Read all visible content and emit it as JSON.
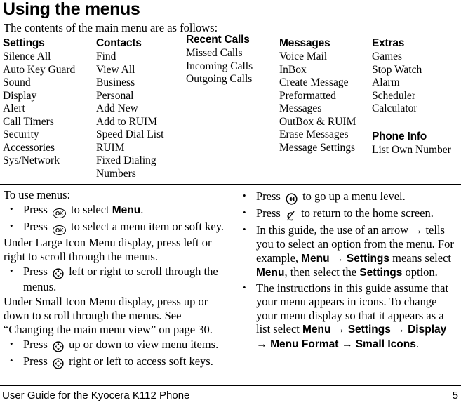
{
  "page": {
    "title": "Using the menus",
    "intro": "The contents of the main menu are as follows:"
  },
  "menu_map": {
    "columns": [
      {
        "heading": "Settings",
        "items": [
          "Silence All",
          "Auto Key Guard",
          "Sound",
          "Display",
          "Alert",
          "Call Timers",
          "Security",
          "Accessories",
          "Sys/Network"
        ]
      },
      {
        "heading": "Contacts",
        "items": [
          "Find",
          "View All",
          "Business",
          "Personal",
          "Add New",
          "Add to RUIM",
          "Speed Dial List",
          "RUIM",
          "Fixed Dialing Numbers"
        ]
      },
      {
        "heading": "Recent Calls",
        "items": [
          "Missed Calls",
          "Incoming Calls",
          "Outgoing Calls"
        ]
      },
      {
        "heading": "Messages",
        "items": [
          "Voice Mail",
          "InBox",
          "Create Message",
          "Preformatted Messages",
          "OutBox & RUIM",
          "Erase Messages",
          "Message Settings"
        ]
      },
      {
        "heading": "Extras",
        "items": [
          "Games",
          "Stop Watch",
          "Alarm",
          "Scheduler",
          "Calculator"
        ],
        "second_heading": "Phone Info",
        "second_items": [
          "List Own Number"
        ]
      }
    ]
  },
  "instructions": {
    "left": {
      "lead": "To use menus:",
      "bullet1_pre": "Press",
      "bullet1_mid": "to select",
      "bullet1_bold": "Menu",
      "bullet1_end": ".",
      "bullet2_pre": "Press",
      "bullet2_post": "to select a menu item or soft key.",
      "para1": "Under Large Icon Menu display, press left or right to scroll through the menus.",
      "bullet3_pre": "Press",
      "bullet3_post": "left or right to scroll through the menus.",
      "para2": "Under Small Icon Menu display, press up or down to scroll through the menus. See “Changing the main menu view” on page 30.",
      "bullet4_pre": "Press",
      "bullet4_post": "up or down to view menu items.",
      "bullet5_pre": "Press",
      "bullet5_post": "right or left to access soft keys."
    },
    "right": {
      "bullet1_pre": "Press",
      "bullet1_post": "to go up a menu level.",
      "bullet2_pre": "Press",
      "bullet2_post": "to return to the home screen.",
      "bullet3_part1": "In this guide, the use of an arrow",
      "bullet3_arrow": "→",
      "bullet3_part2": "tells you to select an option from the menu. For example,",
      "bullet3_menu": "Menu",
      "bullet3_arrow2": "→",
      "bullet3_settings": "Settings",
      "bullet3_part3": "means select",
      "bullet3_menu2": "Menu",
      "bullet3_part4": ", then select the",
      "bullet3_settings2": "Settings",
      "bullet3_part5": "option.",
      "bullet4_part1": "The instructions in this guide assume that your menu appears in icons. To change your menu display so that it appears as a list select",
      "bullet4_menu": "Menu",
      "bullet4_arrow1": "→",
      "bullet4_settings": "Settings",
      "bullet4_arrow2": "→",
      "bullet4_display": "Display",
      "bullet4_arrow3": "→",
      "bullet4_menuformat": "Menu Format",
      "bullet4_arrow4": "→",
      "bullet4_smallicons": "Small Icons",
      "bullet4_period": "."
    }
  },
  "icons": {
    "ok_label": "OK"
  },
  "footer": {
    "text": "User Guide for the Kyocera K112 Phone",
    "page_number": "5"
  }
}
